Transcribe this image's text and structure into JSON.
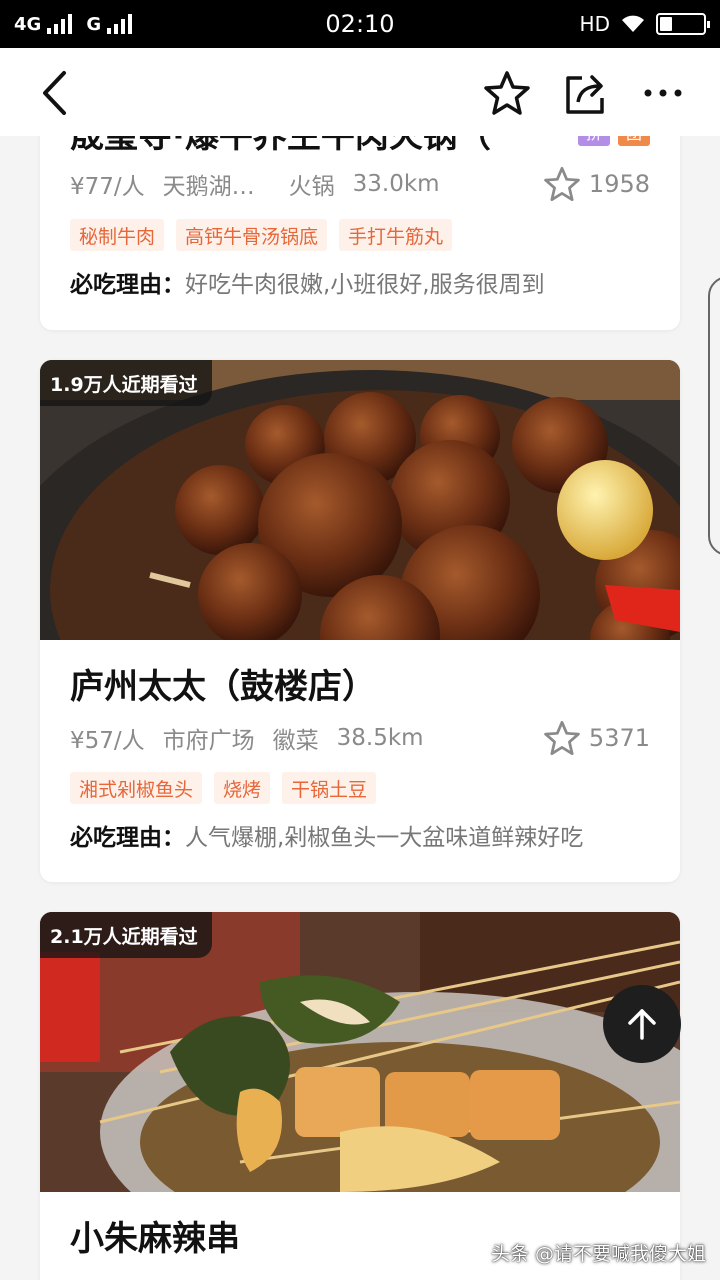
{
  "status_bar": {
    "network_1": "4G",
    "network_2": "G",
    "time": "02:10",
    "hd": "HD"
  },
  "nav": {
    "icons": [
      "back-arrow-icon",
      "star-icon",
      "share-icon",
      "more-icon"
    ]
  },
  "cards": [
    {
      "name": "晟玺寺·爆牛养生牛肉火锅（",
      "badges": [
        "拼",
        "团"
      ],
      "price": "¥77/人",
      "area": "天鹅湖…",
      "cuisine": "火锅",
      "distance": "33.0km",
      "favorites": "1958",
      "tags": [
        "秘制牛肉",
        "高钙牛骨汤锅底",
        "手打牛筋丸"
      ],
      "reason_label": "必吃理由：",
      "reason": "好吃牛肉很嫩,小班很好,服务很周到"
    },
    {
      "views": "1.9万人近期看过",
      "name": "庐州太太（鼓楼店）",
      "price": "¥57/人",
      "area": "市府广场",
      "cuisine": "徽菜",
      "distance": "38.5km",
      "favorites": "5371",
      "tags": [
        "湘式剁椒鱼头",
        "烧烤",
        "干锅土豆"
      ],
      "reason_label": "必吃理由：",
      "reason": "人气爆棚,剁椒鱼头一大盆味道鲜辣好吃"
    },
    {
      "views": "2.1万人近期看过",
      "name": "小朱麻辣串"
    }
  ],
  "watermark": "头条 @请不要喊我傻大姐",
  "colors": {
    "tag_bg": "#fdf1ea",
    "tag_text": "#e8673a",
    "status_bar": "#000000"
  }
}
